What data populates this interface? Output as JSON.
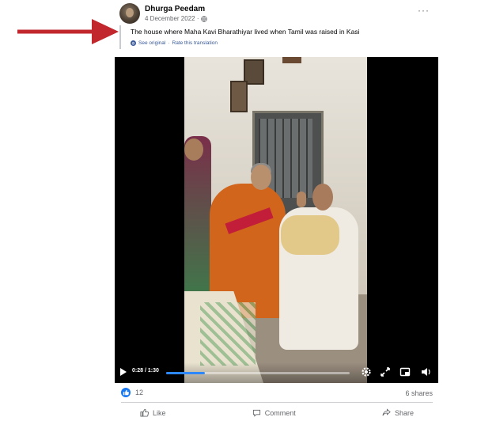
{
  "post": {
    "author": "Dhurga Peedam",
    "date": "4 December 2022 ·",
    "caption": "The house where Maha Kavi Bharathiyar lived when Tamil was raised in Kasi",
    "see_original": "See original",
    "separator": "·",
    "rate_translation": "Rate this translation",
    "more_label": "···"
  },
  "video": {
    "time": "0:28 / 1:30",
    "progress_fraction": 0.21
  },
  "stats": {
    "reaction_count": "12",
    "shares": "6 shares"
  },
  "actions": {
    "like": "Like",
    "comment": "Comment",
    "share": "Share"
  },
  "colors": {
    "arrow": "#c1272d",
    "accent": "#1877f2",
    "progress": "#2d88ff"
  }
}
